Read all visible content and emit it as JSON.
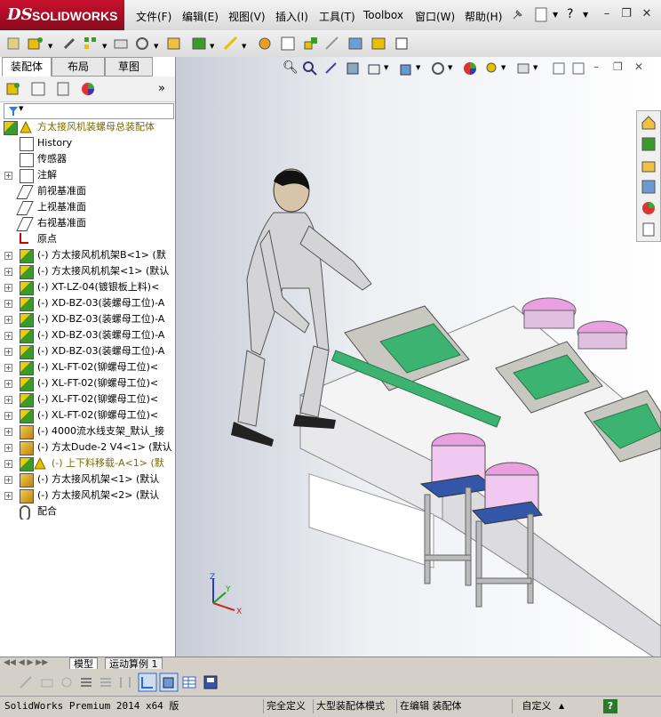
{
  "app": {
    "brand_ds": "DS",
    "brand_name": "SOLIDWORKS"
  },
  "menu": [
    "文件(F)",
    "编辑(E)",
    "视图(V)",
    "插入(I)",
    "工具(T)",
    "Toolbox",
    "窗口(W)",
    "帮助(H)"
  ],
  "window_buttons": {
    "minimize": "–",
    "restore": "❐",
    "close": "✕"
  },
  "panel_tabs": [
    "装配体",
    "布局",
    "草图"
  ],
  "feature_tree": {
    "root": "方太接风机装螺母总装配体",
    "items": [
      {
        "label": "History",
        "icon": "history-icon",
        "expander": ""
      },
      {
        "label": "传感器",
        "icon": "sensor-icon",
        "expander": ""
      },
      {
        "label": "注解",
        "icon": "annotation-icon",
        "expander": "+"
      },
      {
        "label": "前视基准面",
        "icon": "plane-icon",
        "expander": ""
      },
      {
        "label": "上视基准面",
        "icon": "plane-icon",
        "expander": ""
      },
      {
        "label": "右视基准面",
        "icon": "plane-icon",
        "expander": ""
      },
      {
        "label": "原点",
        "icon": "origin-icon",
        "expander": ""
      },
      {
        "label": "(-) 方太接风机机架B<1> (默",
        "icon": "assembly-icon",
        "expander": "+"
      },
      {
        "label": "(-) 方太接风机机架<1> (默认",
        "icon": "assembly-icon",
        "expander": "+"
      },
      {
        "label": "(-) XT-LZ-04(镀银板上料)<",
        "icon": "assembly-icon",
        "expander": "+"
      },
      {
        "label": "(-) XD-BZ-03(装螺母工位)-A",
        "icon": "assembly-icon",
        "expander": "+"
      },
      {
        "label": "(-) XD-BZ-03(装螺母工位)-A",
        "icon": "assembly-icon",
        "expander": "+"
      },
      {
        "label": "(-) XD-BZ-03(装螺母工位)-A",
        "icon": "assembly-icon",
        "expander": "+"
      },
      {
        "label": "(-) XD-BZ-03(装螺母工位)-A",
        "icon": "assembly-icon",
        "expander": "+"
      },
      {
        "label": "(-) XL-FT-02(铆螺母工位)<",
        "icon": "assembly-icon",
        "expander": "+"
      },
      {
        "label": "(-) XL-FT-02(铆螺母工位)<",
        "icon": "assembly-icon",
        "expander": "+"
      },
      {
        "label": "(-) XL-FT-02(铆螺母工位)<",
        "icon": "assembly-icon",
        "expander": "+"
      },
      {
        "label": "(-) XL-FT-02(铆螺母工位)<",
        "icon": "assembly-icon",
        "expander": "+"
      },
      {
        "label": "(-) 4000流水线支架_默认_接",
        "icon": "part-icon",
        "expander": "+"
      },
      {
        "label": "(-) 方太Dude-2 V4<1> (默认",
        "icon": "part-icon",
        "expander": "+"
      },
      {
        "label": "(-) 上下料移载-A<1> (默",
        "icon": "assembly-icon",
        "expander": "+",
        "warning": true
      },
      {
        "label": "(-) 方太接风机架<1> (默认",
        "icon": "part-icon",
        "expander": "+"
      },
      {
        "label": "(-) 方太接风机架<2> (默认",
        "icon": "part-icon",
        "expander": "+"
      },
      {
        "label": "配合",
        "icon": "mates-icon",
        "expander": ""
      }
    ]
  },
  "bottom_tabs": [
    "模型",
    "运动算例 1"
  ],
  "status": {
    "product": "SolidWorks Premium 2014 x64 版",
    "definition": "完全定义",
    "mode": "大型装配体模式",
    "editing": "在编辑 装配体",
    "units": "自定义",
    "help": "?"
  },
  "colors": {
    "brand_red": "#c8102e",
    "warning_yellow": "#e8c000",
    "machine_green": "#3cb371",
    "bowl_pink": "#e8a0e0"
  },
  "triad": {
    "x": "X",
    "y": "Y",
    "z": "Z"
  }
}
